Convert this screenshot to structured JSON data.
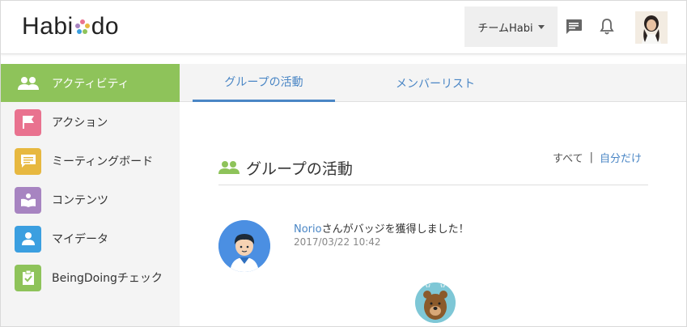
{
  "header": {
    "logo_text_left": "Habi",
    "logo_text_right": "do",
    "team_label": "チームHabi",
    "icons": [
      "chat-icon",
      "bell-icon",
      "user-avatar"
    ]
  },
  "sidebar": {
    "items": [
      {
        "label": "アクティビティ",
        "icon": "people-icon",
        "color": "#8ec35a",
        "active": true
      },
      {
        "label": "アクション",
        "icon": "flag-icon",
        "color": "#e9728f"
      },
      {
        "label": "ミーティングボード",
        "icon": "chat-board-icon",
        "color": "#e7b840"
      },
      {
        "label": "コンテンツ",
        "icon": "book-icon",
        "color": "#a784c1"
      },
      {
        "label": "マイデータ",
        "icon": "person-icon",
        "color": "#3b9fe0"
      },
      {
        "label": "BeingDoingチェック",
        "icon": "clipboard-check-icon",
        "color": "#8ec35a"
      }
    ]
  },
  "tabs": [
    {
      "label": "グループの活動",
      "active": true
    },
    {
      "label": "メンバーリスト",
      "active": false
    }
  ],
  "section": {
    "title": "グループの活動",
    "filter_all": "すべて",
    "filter_separator": "|",
    "filter_mine": "自分だけ"
  },
  "feed": [
    {
      "user": "Norio",
      "text": "さんがバッジを獲得しました！",
      "timestamp": "2017/03/22 10:42",
      "badge": "bear-badge-icon"
    }
  ],
  "colors": {
    "accent": "#8ec35a",
    "link": "#4a86c5"
  }
}
